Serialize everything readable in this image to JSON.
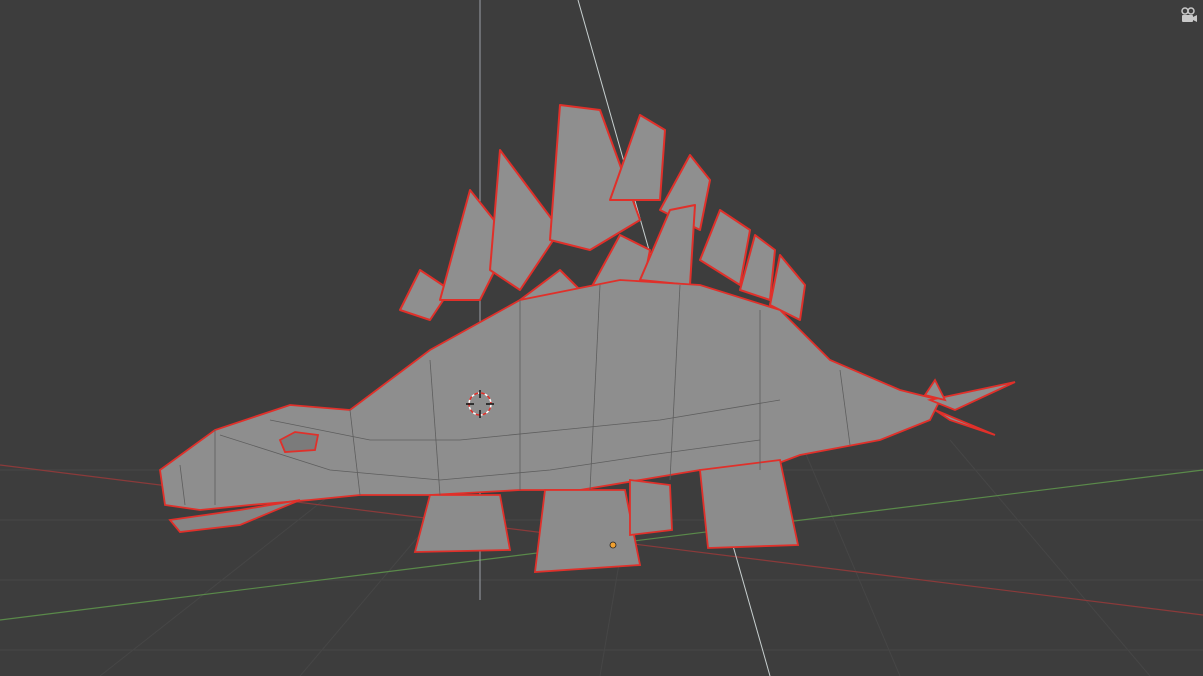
{
  "viewport": {
    "background": "#3d3d3d",
    "axis_x_color": "#8b3a3a",
    "axis_y_color": "#5a8a4a",
    "axis_z_color": "#9aa0a6",
    "seam_color": "#e0302a",
    "mesh_color": "#8e8e8e"
  },
  "scene": {
    "object": "stegosaurus-mesh",
    "mode": "edit",
    "seams_visible": true
  },
  "icons": {
    "camera": "camera-view-icon",
    "cursor": "3d-cursor-icon",
    "origin": "object-origin-icon"
  }
}
